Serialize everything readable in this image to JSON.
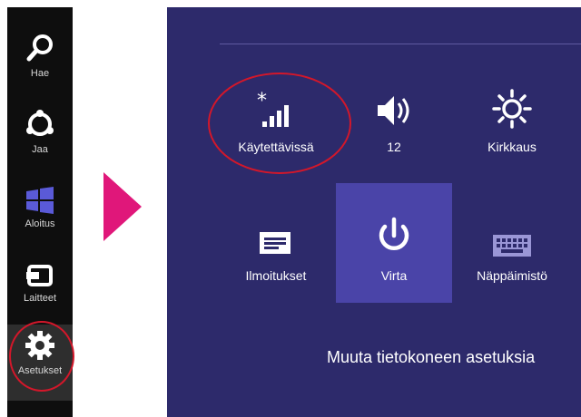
{
  "charms": [
    {
      "label": "Hae",
      "icon": "search-icon"
    },
    {
      "label": "Jaa",
      "icon": "share-icon"
    },
    {
      "label": "Aloitus",
      "icon": "windows-start-icon"
    },
    {
      "label": "Laitteet",
      "icon": "devices-icon"
    },
    {
      "label": "Asetukset",
      "icon": "settings-gear-icon",
      "selected": true
    }
  ],
  "settings": {
    "tiles": [
      {
        "label": "Käytettävissä",
        "icon": "network-signal-icon"
      },
      {
        "label": "12",
        "icon": "volume-icon"
      },
      {
        "label": "Kirkkaus",
        "icon": "brightness-icon"
      },
      {
        "label": "Ilmoitukset",
        "icon": "notifications-icon"
      },
      {
        "label": "Virta",
        "icon": "power-icon",
        "active": true
      },
      {
        "label": "Näppäimistö",
        "icon": "keyboard-icon"
      }
    ],
    "change_pc_settings": "Muuta tietokoneen asetuksia"
  },
  "colors": {
    "panel_bg": "#2d2a6b",
    "tile_active": "#4a44a8",
    "charms_bg": "#0e0e0e",
    "arrow": "#e0177a",
    "highlight_circle": "#d3172a"
  }
}
